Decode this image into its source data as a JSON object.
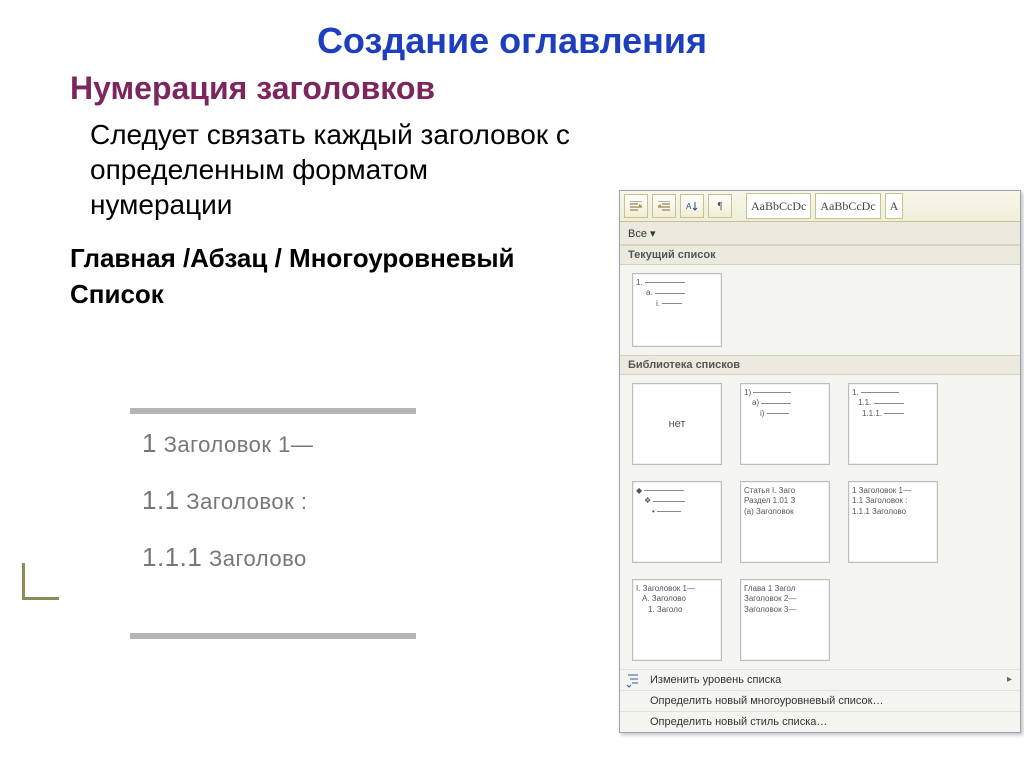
{
  "title": "Создание оглавления",
  "subtitle": "Нумерация заголовков",
  "body": "Следует связать каждый заголовок с определенным форматом нумерации",
  "path": "Главная /Абзац / Многоуровневый Список",
  "sample": {
    "l1_num": "1",
    "l1_txt": "Заголовок 1—",
    "l2_num": "1.1",
    "l2_txt": "Заголовок :",
    "l3_num": "1.1.1",
    "l3_txt": "Заголово"
  },
  "ribbon": {
    "style_a": "AaBbCcDc",
    "style_b": "AaBbCcDc",
    "style_c": "A"
  },
  "panel": {
    "tab_all": "Все ▾",
    "section_current": "Текущий список",
    "section_library": "Библиотека списков",
    "none_label": "нет",
    "thumbs": {
      "cur1": {
        "a": "1.",
        "b": "a.",
        "c": "i."
      },
      "lib1b": {
        "a": "1)",
        "b": "a)",
        "c": "i)"
      },
      "lib1c": {
        "a": "1.",
        "b": "1.1.",
        "c": "1.1.1."
      },
      "lib2b": {
        "a": "Статья I. Заго",
        "b": "Раздел 1.01 З",
        "c": "(a) Заголовок"
      },
      "lib2c": {
        "a": "1 Заголовок 1—",
        "b": "1.1 Заголовок :",
        "c": "1.1.1 Заголово"
      },
      "lib3a": {
        "a": "I. Заголовок 1—",
        "b": "A. Заголово",
        "c": "1. Заголо"
      },
      "lib3b": {
        "a": "Глава 1 Загол",
        "b": "Заголовок 2—",
        "c": "Заголовок 3—"
      }
    },
    "menu_change_level": "Изменить уровень списка",
    "menu_define_multi": "Определить новый многоуровневый список…",
    "menu_define_style": "Определить новый стиль списка…"
  }
}
